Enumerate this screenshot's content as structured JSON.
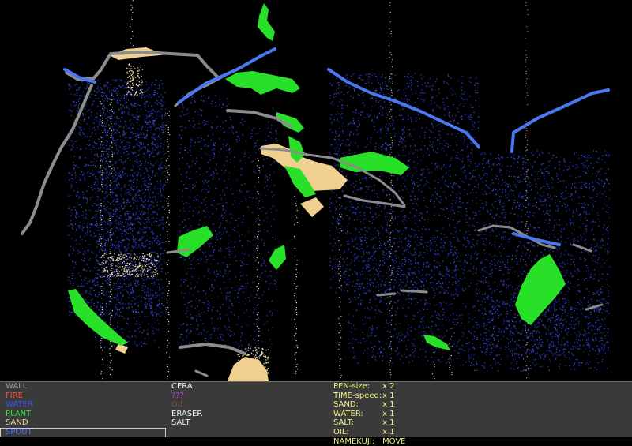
{
  "elements_left": [
    {
      "label": "WALL",
      "color": "#9a9a9a"
    },
    {
      "label": "FIRE",
      "color": "#ff5030"
    },
    {
      "label": "WATER",
      "color": "#3c50ff"
    },
    {
      "label": "PLANT",
      "color": "#30e030"
    },
    {
      "label": "SAND",
      "color": "#f0d8a0"
    },
    {
      "label": "SPOUT",
      "color": "#5070ff",
      "selected": true
    }
  ],
  "elements_right": [
    {
      "label": "CERA",
      "color": "#f0f0f0"
    },
    {
      "label": "???",
      "color": "#c040e0"
    },
    {
      "label": "OIL",
      "color": "#8a4a30"
    },
    {
      "label": "ERASER",
      "color": "#f0f0f0"
    },
    {
      "label": "SALT",
      "color": "#f0f0f0"
    }
  ],
  "stats": [
    {
      "key": "PEN-size:",
      "value": "x 2"
    },
    {
      "key": "TIME-speed:",
      "value": "x 1"
    },
    {
      "key": "SAND:",
      "value": "x 1"
    },
    {
      "key": "WATER:",
      "value": "x 1"
    },
    {
      "key": "SALT:",
      "value": "x 1"
    },
    {
      "key": "OIL:",
      "value": "x 1"
    },
    {
      "key": "NAMEKUJI:",
      "value": "MOVE"
    }
  ],
  "colors": {
    "wall": "#8c8c8c",
    "water": "#2a35c8",
    "water_edge": "#4a78f0",
    "plant": "#28e028",
    "sand": "#f0d090",
    "panel_bg": "#3a3a3a",
    "stats_text": "#f0f080"
  }
}
